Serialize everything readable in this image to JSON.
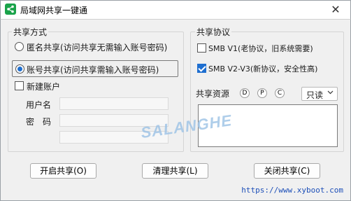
{
  "window": {
    "title": "局域网共享一键通",
    "close_glyph": "✕",
    "icon": "share-icon"
  },
  "share_mode": {
    "group_label": "共享方式",
    "options": [
      {
        "label": "匿名共享(访问共享无需输入账号密码)",
        "selected": false
      },
      {
        "label": "账号共享(访问共享需输入账号密码)",
        "selected": true
      }
    ],
    "new_account": {
      "label": "新建账户",
      "checked": false
    },
    "username_label": "用户名",
    "username_value": "",
    "password_label": "密　码",
    "password_value": ""
  },
  "protocol": {
    "group_label": "共享协议",
    "smb_v1": {
      "label": "SMB V1(老协议，旧系统需要)",
      "checked": false
    },
    "smb_v2": {
      "label": "SMB V2-V3(新协议，安全性高)",
      "checked": true
    }
  },
  "resources": {
    "label": "共享资源",
    "drives": [
      "D",
      "P",
      "C"
    ],
    "access": "只读"
  },
  "buttons": {
    "open": "开启共享(O)",
    "clean": "清理共享(L)",
    "close": "关闭共享(C)"
  },
  "footer_url": "https://www.xyboot.com",
  "watermark": "SALANGHE"
}
